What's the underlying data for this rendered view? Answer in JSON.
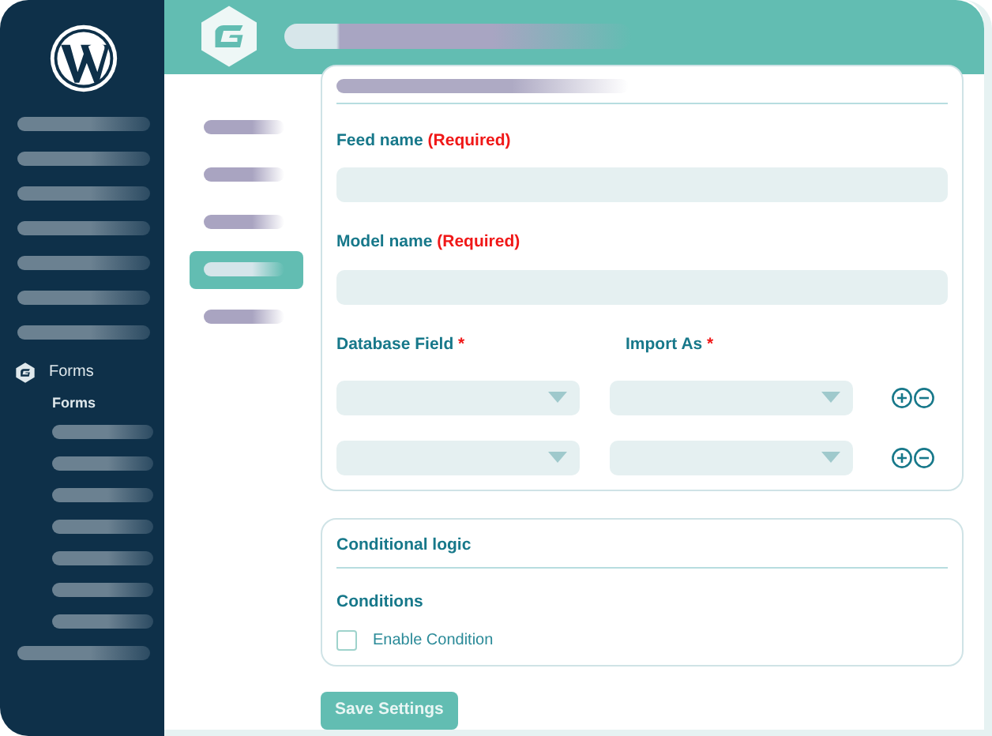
{
  "sidebar": {
    "items": [
      {
        "kind": "placeholder"
      },
      {
        "kind": "placeholder"
      },
      {
        "kind": "placeholder"
      },
      {
        "kind": "placeholder"
      },
      {
        "kind": "placeholder"
      },
      {
        "kind": "placeholder"
      },
      {
        "kind": "placeholder"
      },
      {
        "kind": "menu",
        "label": "Forms",
        "children": [
          {
            "kind": "text",
            "label": "Forms"
          },
          {
            "kind": "placeholder"
          },
          {
            "kind": "placeholder"
          },
          {
            "kind": "placeholder"
          },
          {
            "kind": "placeholder"
          },
          {
            "kind": "placeholder"
          },
          {
            "kind": "placeholder"
          },
          {
            "kind": "placeholder"
          }
        ]
      },
      {
        "kind": "placeholder"
      }
    ]
  },
  "settings_nav": [
    {
      "selected": false
    },
    {
      "selected": false
    },
    {
      "selected": false
    },
    {
      "selected": true
    },
    {
      "selected": false
    }
  ],
  "feed_settings": {
    "fields": [
      {
        "label": "Feed name",
        "required": "(Required)"
      },
      {
        "label": "Model name",
        "required": "(Required)"
      }
    ],
    "mapping": {
      "columns": [
        {
          "label": "Database Field",
          "required": "*"
        },
        {
          "label": "Import As",
          "required": "*"
        }
      ],
      "rows": [
        {},
        {}
      ]
    }
  },
  "conditional_logic": {
    "title": "Conditional logic",
    "subtitle": "Conditions",
    "checkbox": {
      "label": "Enable Condition",
      "checked": false
    }
  },
  "save_button": "Save Settings"
}
